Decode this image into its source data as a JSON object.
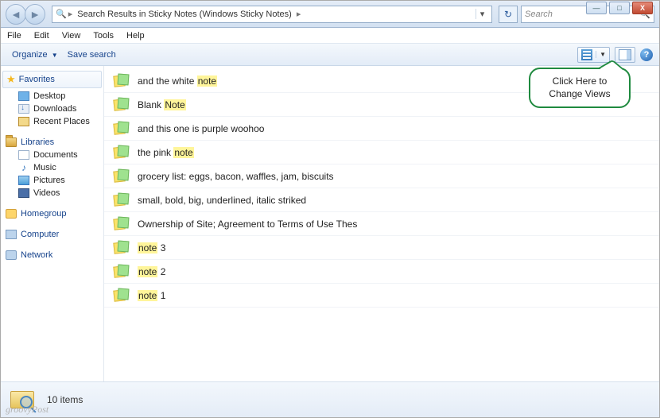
{
  "window": {
    "minimize": "—",
    "maximize": "□",
    "close": "X"
  },
  "address": {
    "icon": "🔍",
    "crumb1": "Search Results in Sticky Notes (Windows Sticky Notes)",
    "refresh": "↻"
  },
  "search": {
    "placeholder": "Search",
    "icon": "🔍"
  },
  "menu": {
    "file": "File",
    "edit": "Edit",
    "view": "View",
    "tools": "Tools",
    "help": "Help"
  },
  "toolbar": {
    "organize": "Organize",
    "save_search": "Save search",
    "help": "?"
  },
  "callout": {
    "line1": "Click Here to",
    "line2": "Change Views"
  },
  "sidebar": {
    "favorites_label": "Favorites",
    "favorites": [
      {
        "label": "Desktop"
      },
      {
        "label": "Downloads"
      },
      {
        "label": "Recent Places"
      }
    ],
    "libraries_label": "Libraries",
    "libraries": [
      {
        "label": "Documents"
      },
      {
        "label": "Music"
      },
      {
        "label": "Pictures"
      },
      {
        "label": "Videos"
      }
    ],
    "homegroup": "Homegroup",
    "computer": "Computer",
    "network": "Network"
  },
  "results": [
    {
      "parts": [
        {
          "t": "and the white ",
          "h": false
        },
        {
          "t": "note",
          "h": true
        }
      ]
    },
    {
      "parts": [
        {
          "t": "Blank ",
          "h": false
        },
        {
          "t": "Note",
          "h": true
        }
      ]
    },
    {
      "parts": [
        {
          "t": "and this one is purple woohoo",
          "h": false
        }
      ]
    },
    {
      "parts": [
        {
          "t": "the pink ",
          "h": false
        },
        {
          "t": "note",
          "h": true
        }
      ]
    },
    {
      "parts": [
        {
          "t": "grocery list: eggs, bacon, waffles, jam, biscuits",
          "h": false
        }
      ]
    },
    {
      "parts": [
        {
          "t": "small, bold,  big,  underlined, italic striked",
          "h": false
        }
      ]
    },
    {
      "parts": [
        {
          "t": "Ownership of Site; Agreement to Terms of Use Thes",
          "h": false
        }
      ]
    },
    {
      "parts": [
        {
          "t": "note",
          "h": true
        },
        {
          "t": " 3",
          "h": false
        }
      ]
    },
    {
      "parts": [
        {
          "t": "note",
          "h": true
        },
        {
          "t": " 2",
          "h": false
        }
      ]
    },
    {
      "parts": [
        {
          "t": "note",
          "h": true
        },
        {
          "t": " 1",
          "h": false
        }
      ]
    }
  ],
  "status": {
    "text": "10 items"
  },
  "watermark": "groovyPost"
}
